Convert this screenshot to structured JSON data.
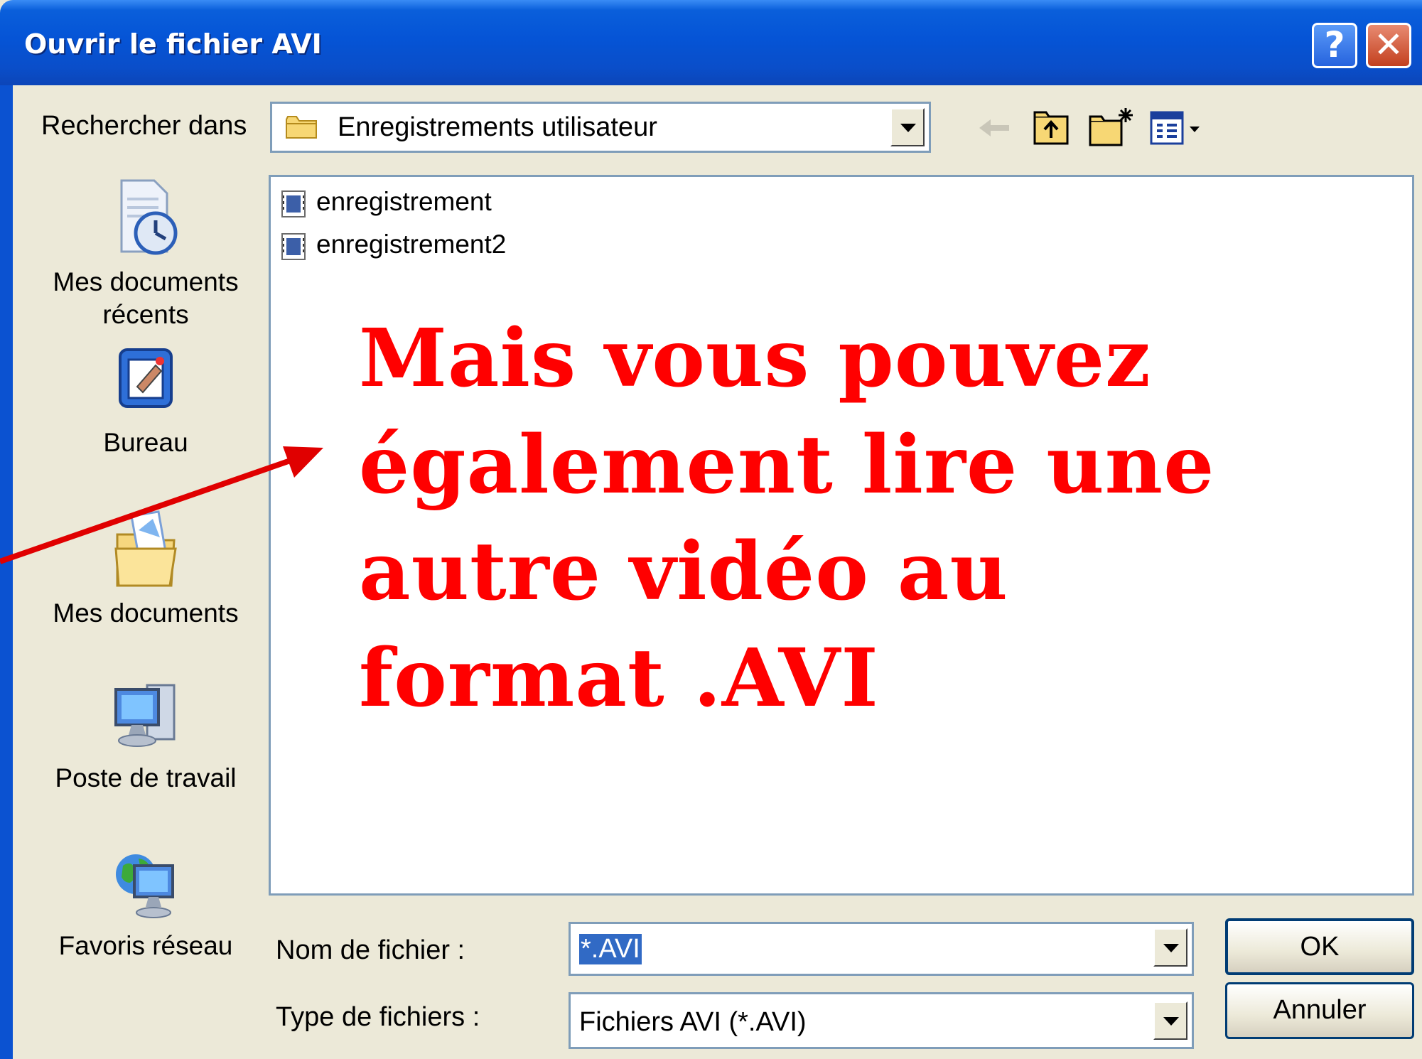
{
  "window": {
    "title": "Ouvrir le fichier AVI"
  },
  "titlebar": {
    "help_symbol": "?",
    "close_symbol": "✕"
  },
  "lookin": {
    "label": "Rechercher dans",
    "value": "Enregistrements utilisateur"
  },
  "places": [
    {
      "label": "Mes documents récents",
      "icon": "recent-documents-icon"
    },
    {
      "label": "Bureau",
      "icon": "desktop-icon"
    },
    {
      "label": "Mes documents",
      "icon": "my-documents-icon"
    },
    {
      "label": "Poste de travail",
      "icon": "my-computer-icon"
    },
    {
      "label": "Favoris réseau",
      "icon": "network-places-icon"
    }
  ],
  "files": [
    {
      "name": "enregistrement"
    },
    {
      "name": "enregistrement2"
    }
  ],
  "overlay": {
    "lines": [
      "Mais vous pouvez",
      "également lire une",
      "autre vidéo au",
      "format .AVI"
    ],
    "color": "#ff0000"
  },
  "filename": {
    "label": "Nom de fichier :",
    "value": "*.AVI"
  },
  "filetype": {
    "label": "Type de fichiers :",
    "value": "Fichiers AVI (*.AVI)"
  },
  "buttons": {
    "ok": "OK",
    "cancel": "Annuler"
  }
}
